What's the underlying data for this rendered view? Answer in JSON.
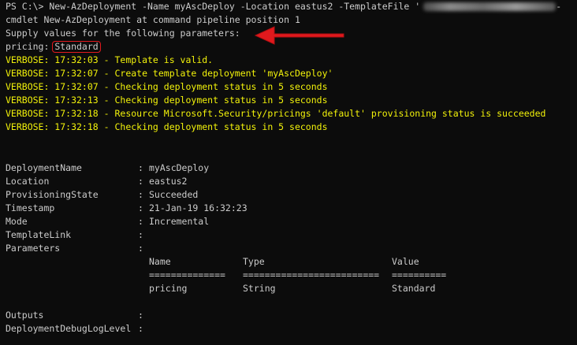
{
  "terminal": {
    "prompt_line": "PS C:\\> New-AzDeployment -Name myAscDeploy -Location eastus2 -TemplateFile '",
    "prompt_tail": "-",
    "cmdlet_line": "cmdlet New-AzDeployment at command pipeline position 1",
    "supply_line": "Supply values for the following parameters:",
    "pricing_label": "pricing: ",
    "pricing_value": "Standard",
    "verbose": [
      "VERBOSE: 17:32:03 - Template is valid.",
      "VERBOSE: 17:32:07 - Create template deployment 'myAscDeploy'",
      "VERBOSE: 17:32:07 - Checking deployment status in 5 seconds",
      "VERBOSE: 17:32:13 - Checking deployment status in 5 seconds",
      "VERBOSE: 17:32:18 - Resource Microsoft.Security/pricings 'default' provisioning status is succeeded",
      "VERBOSE: 17:32:18 - Checking deployment status in 5 seconds"
    ],
    "properties": [
      {
        "label": "DeploymentName",
        "value": "myAscDeploy"
      },
      {
        "label": "Location",
        "value": "eastus2"
      },
      {
        "label": "ProvisioningState",
        "value": "Succeeded"
      },
      {
        "label": "Timestamp",
        "value": "21-Jan-19 16:32:23"
      },
      {
        "label": "Mode",
        "value": "Incremental"
      },
      {
        "label": "TemplateLink",
        "value": ""
      },
      {
        "label": "Parameters",
        "value": ""
      }
    ],
    "separator": ":",
    "param_table": {
      "headers": [
        "Name",
        "Type",
        "Value"
      ],
      "rules": [
        "==============",
        "=========================",
        "=========="
      ],
      "rows": [
        [
          "pricing",
          "String",
          "Standard"
        ]
      ]
    },
    "outputs_label": "Outputs",
    "debug_label": "DeploymentDebugLogLevel"
  },
  "colors": {
    "background": "#0c0c0c",
    "text": "#cccccc",
    "verbose": "#f2f20a",
    "annotation": "#e0191d"
  },
  "annotation": {
    "arrow_icon": "red-arrow-left-icon",
    "highlight_box": "red-highlight-box"
  }
}
